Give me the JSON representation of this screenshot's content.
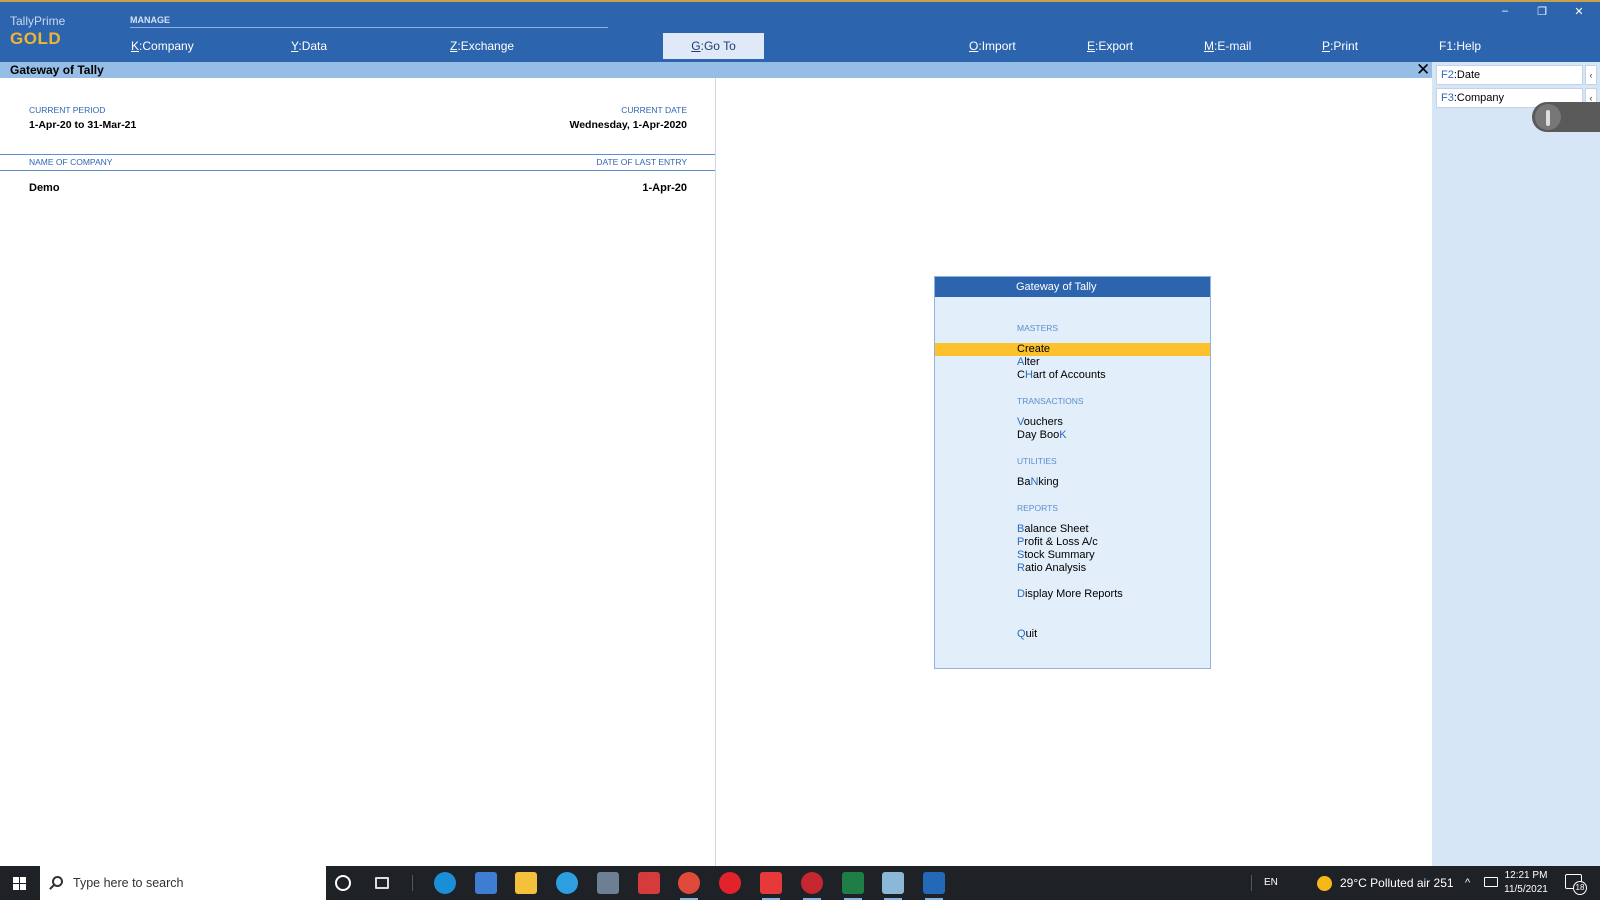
{
  "app": {
    "name": "TallyPrime",
    "edition": "GOLD"
  },
  "topbar": {
    "manage_label": "MANAGE",
    "buttons": [
      {
        "key": "K",
        "label": "Company"
      },
      {
        "key": "Y",
        "label": "Data"
      },
      {
        "key": "Z",
        "label": "Exchange"
      },
      {
        "key": "G",
        "label": "Go To"
      },
      {
        "key": "O",
        "label": "Import"
      },
      {
        "key": "E",
        "label": "Export"
      },
      {
        "key": "M",
        "label": "E-mail"
      },
      {
        "key": "P",
        "label": "Print"
      },
      {
        "key": "F1",
        "label": "Help"
      }
    ],
    "window_controls": {
      "minimize": "–",
      "restore": "❐",
      "close": "✕"
    }
  },
  "title": "Gateway of Tally",
  "close_symbol": "✕",
  "info": {
    "current_period_caption": "CURRENT PERIOD",
    "current_period": "1-Apr-20 to 31-Mar-21",
    "current_date_caption": "CURRENT DATE",
    "current_date": "Wednesday, 1-Apr-2020",
    "company_caption": "NAME OF COMPANY",
    "last_entry_caption": "DATE OF LAST ENTRY",
    "company_name": "Demo",
    "last_entry_date": "1-Apr-20"
  },
  "right_panel": {
    "buttons": [
      {
        "key": "F2",
        "label": "Date"
      },
      {
        "key": "F3",
        "label": "Company"
      }
    ],
    "chevron": "‹"
  },
  "gateway": {
    "title": "Gateway of Tally",
    "sections": [
      {
        "heading": "MASTERS",
        "items": [
          {
            "pre": "",
            "hot": "C",
            "post": "reate",
            "active": true
          },
          {
            "pre": "",
            "hot": "A",
            "post": "lter"
          },
          {
            "pre": "C",
            "hot": "H",
            "post": "art of Accounts"
          }
        ]
      },
      {
        "heading": "TRANSACTIONS",
        "items": [
          {
            "pre": "",
            "hot": "V",
            "post": "ouchers"
          },
          {
            "pre": "Day Boo",
            "hot": "K",
            "post": ""
          }
        ]
      },
      {
        "heading": "UTILITIES",
        "items": [
          {
            "pre": "Ba",
            "hot": "N",
            "post": "king"
          }
        ]
      },
      {
        "heading": "REPORTS",
        "items": [
          {
            "pre": "",
            "hot": "B",
            "post": "alance Sheet"
          },
          {
            "pre": "",
            "hot": "P",
            "post": "rofit & Loss A/c"
          },
          {
            "pre": "",
            "hot": "S",
            "post": "tock Summary"
          },
          {
            "pre": "",
            "hot": "R",
            "post": "atio Analysis"
          },
          {
            "pre": "",
            "hot": "D",
            "post": "isplay More Reports"
          }
        ]
      },
      {
        "heading": "",
        "items": [
          {
            "pre": "",
            "hot": "Q",
            "post": "uit"
          }
        ]
      }
    ]
  },
  "taskbar": {
    "search_placeholder": "Type here to search",
    "language": "EN",
    "weather": "29°C  Polluted air 251",
    "time": "12:21 PM",
    "date": "11/5/2021",
    "notification_count": "18",
    "apps": [
      "cortana-icon",
      "task-view-icon",
      "edge-icon",
      "store-icon",
      "file-explorer-icon",
      "internet-explorer-icon",
      "calculator-icon",
      "mail-icon",
      "chrome-icon",
      "opera-icon",
      "anydesk-icon",
      "app-red-icon",
      "excel-icon",
      "notes-icon",
      "tally-icon"
    ],
    "colors": {
      "edge": "#1a8fd8",
      "store": "#3f7dd3",
      "explorer": "#f3c13b",
      "ie": "#2d9fe0",
      "calculator": "#6c7f93",
      "mail": "#d63b3b",
      "chrome": "#e04a3a",
      "opera": "#e3232b",
      "anydesk": "#e8393a",
      "app_red": "#c6262f",
      "excel": "#1e7e45",
      "notes": "#8cb8d8",
      "tally": "#2468b8"
    }
  }
}
